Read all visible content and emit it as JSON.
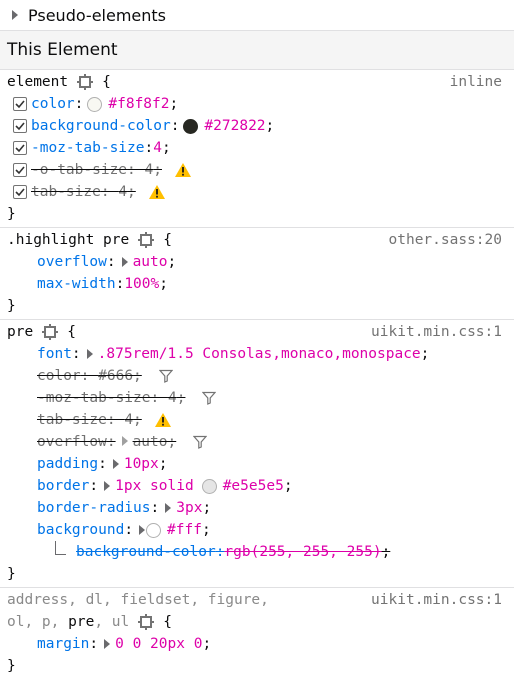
{
  "pseudo_elements": {
    "label": "Pseudo-elements"
  },
  "section": {
    "title": "This Element"
  },
  "rules": [
    {
      "selector": "element",
      "source": "inline",
      "open_brace": "{",
      "close_brace": "}",
      "declarations": [
        {
          "name": "color",
          "value": "#f8f8f2",
          "swatch": "#f8f8f2"
        },
        {
          "name": "background-color",
          "value": "#272822",
          "swatch": "#272822"
        },
        {
          "name": "-moz-tab-size",
          "value": "4"
        },
        {
          "name": "-o-tab-size",
          "value": "4"
        },
        {
          "name": "tab-size",
          "value": "4"
        }
      ]
    },
    {
      "selector": ".highlight pre",
      "source": "other.sass:20",
      "open_brace": "{",
      "close_brace": "}",
      "declarations": [
        {
          "name": "overflow",
          "value": "auto"
        },
        {
          "name": "max-width",
          "value": "100%"
        }
      ]
    },
    {
      "selector": "pre",
      "source": "uikit.min.css:1",
      "open_brace": "{",
      "close_brace": "}",
      "declarations": [
        {
          "name": "font",
          "value": ".875rem/1.5 Consolas,monaco,monospace"
        },
        {
          "name": "color",
          "value": "#666"
        },
        {
          "name": "-moz-tab-size",
          "value": "4"
        },
        {
          "name": "tab-size",
          "value": "4"
        },
        {
          "name": "overflow",
          "value": "auto"
        },
        {
          "name": "padding",
          "value": "10px"
        },
        {
          "name": "border",
          "value": "1px solid",
          "value2": "#e5e5e5",
          "swatch": "#e5e5e5"
        },
        {
          "name": "border-radius",
          "value": "3px"
        },
        {
          "name": "background",
          "value": "#fff",
          "swatch": "#ffffff"
        },
        {
          "name": "background-color",
          "value": "rgb(255, 255, 255)"
        }
      ]
    },
    {
      "selector_line1": "address, dl, fieldset, figure,",
      "selector_line2_a": "ol, p, ",
      "selector_line2_match": "pre",
      "selector_line2_b": ", ul",
      "source": "uikit.min.css:1",
      "open_brace": "{",
      "close_brace": "}",
      "declarations": [
        {
          "name": "margin",
          "value": "0 0 20px 0"
        }
      ]
    }
  ],
  "colors": {
    "property": "#0074e8",
    "value": "#dd00a9",
    "warning": "#ffbf00",
    "source": "#737373"
  }
}
